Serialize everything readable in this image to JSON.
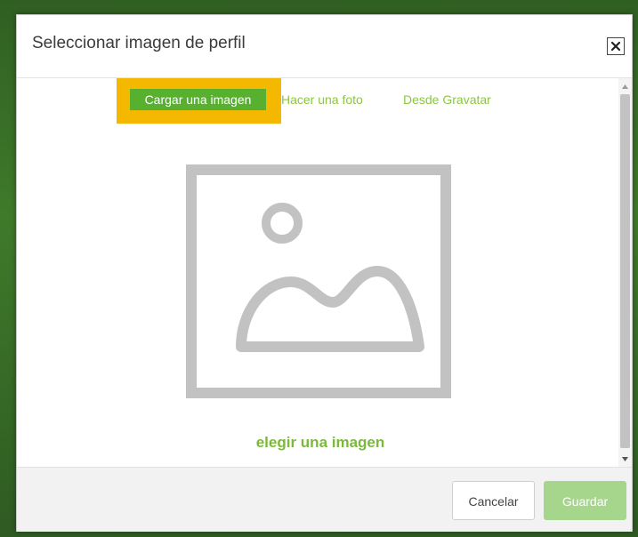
{
  "dialog": {
    "title": "Seleccionar imagen de perfil",
    "close_icon": "close-icon"
  },
  "tabs": [
    {
      "label": "Cargar una imagen",
      "active": true
    },
    {
      "label": "Hacer una foto",
      "active": false
    },
    {
      "label": "Desde Gravatar",
      "active": false
    }
  ],
  "body": {
    "placeholder_icon": "image-placeholder-icon",
    "choose_link": "elegir una imagen"
  },
  "footer": {
    "cancel_label": "Cancelar",
    "save_label": "Guardar"
  },
  "colors": {
    "accent_green": "#58b12e",
    "link_green": "#8cc63f",
    "highlight": "#f5b800",
    "save_disabled": "#a6d68c",
    "placeholder_gray": "#c2c2c2"
  }
}
